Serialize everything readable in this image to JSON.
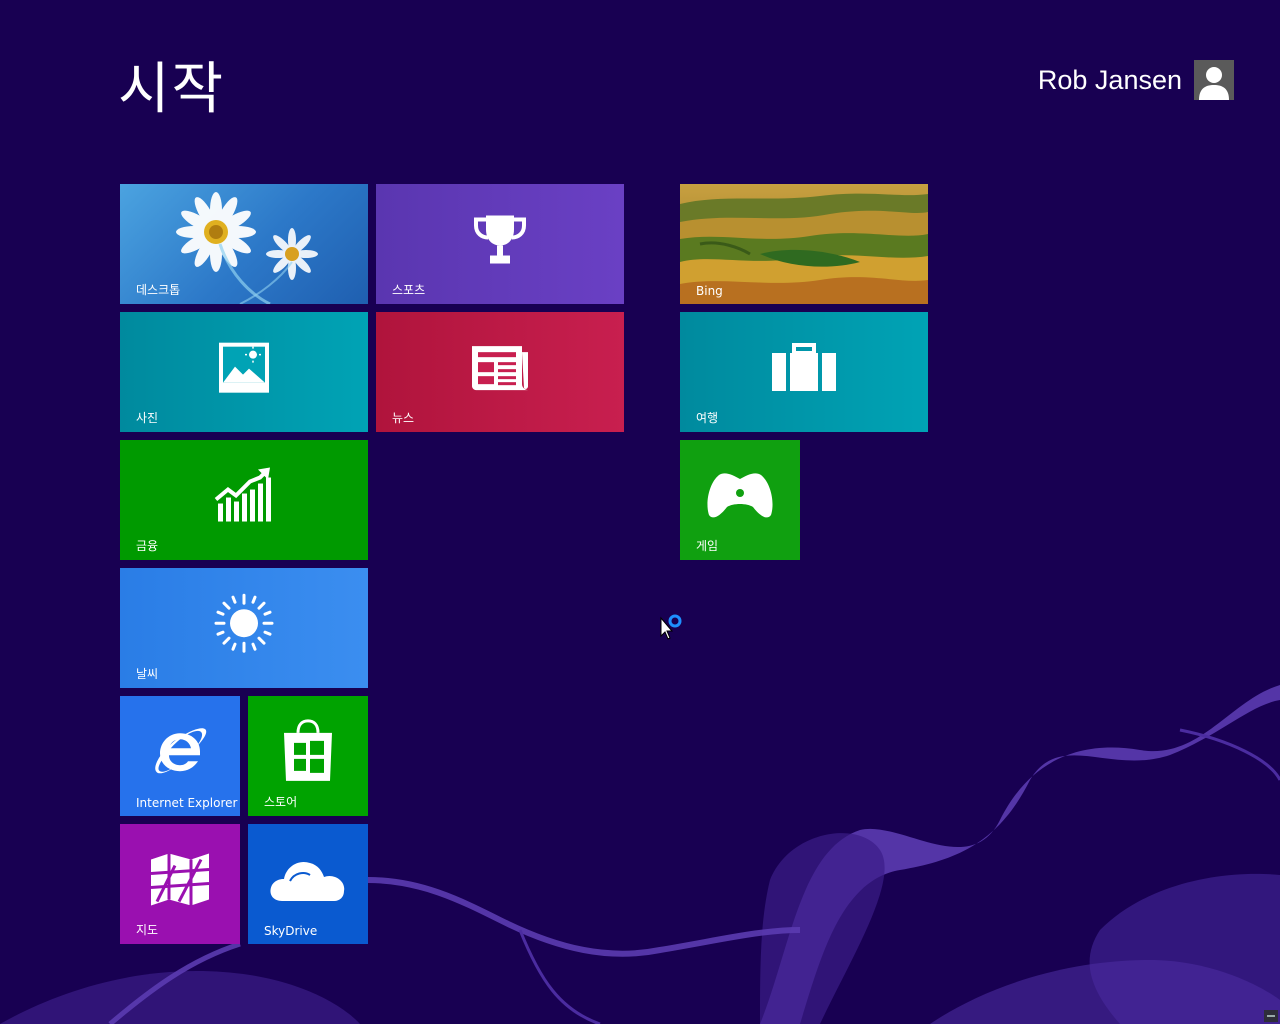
{
  "start": {
    "title": "시작",
    "user": {
      "name": "Rob Jansen"
    }
  },
  "tiles": {
    "desktop": {
      "label": "데스크톱"
    },
    "sports": {
      "label": "스포츠"
    },
    "bing": {
      "label": "Bing"
    },
    "photos": {
      "label": "사진"
    },
    "news": {
      "label": "뉴스"
    },
    "travel": {
      "label": "여행"
    },
    "finance": {
      "label": "금융"
    },
    "games": {
      "label": "게임"
    },
    "weather": {
      "label": "날씨"
    },
    "ie": {
      "label": "Internet Explorer"
    },
    "store": {
      "label": "스토어"
    },
    "maps": {
      "label": "지도"
    },
    "skydrive": {
      "label": "SkyDrive"
    }
  },
  "colors": {
    "background": "#180052",
    "accent_swirl": "#5b3bb0",
    "sports": "#5a36b0",
    "news": "#c81f4f",
    "teal": "#00a3b5",
    "green": "#009a00",
    "blue": "#2672ec",
    "magenta": "#9a10b0"
  }
}
